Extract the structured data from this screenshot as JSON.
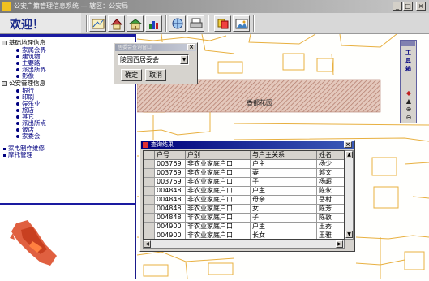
{
  "window": {
    "title": "公安户籍管理信息系统 — 辖区：公安局",
    "controls": {
      "minimize": "_",
      "maximize": "□",
      "close": "×"
    }
  },
  "welcome": "欢迎！",
  "toolbar": {
    "buttons": [
      "map-icon",
      "house-icon",
      "building-icon",
      "chart-icon",
      "globe-icon",
      "print-icon",
      "layers-icon",
      "photo-icon"
    ]
  },
  "tree": {
    "group1": "基础地理信息",
    "group1_items": [
      "家属会界",
      "建筑物",
      "主要路",
      "派出所界",
      "影像"
    ],
    "group2": "公安管理信息",
    "group2_items": [
      "银行",
      "印刷",
      "娱乐业",
      "旅店",
      "其它",
      "派出所点",
      "饭店",
      "家委会"
    ],
    "extra": [
      "家电制作维修",
      "摩托管理"
    ]
  },
  "select_dialog": {
    "title": "居委会查询窗口",
    "selected": "陵园西居委会",
    "ok": "确定",
    "cancel": "取消"
  },
  "map": {
    "area_label": "香都花园"
  },
  "palette": {
    "title": "工具箱",
    "tools": [
      "palette-icon",
      "pointer-icon",
      "zoom-in-icon",
      "zoom-out-icon"
    ]
  },
  "results": {
    "title": "查询结果",
    "columns": [
      "户号",
      "户别",
      "与户主关系",
      "姓名"
    ],
    "rows": [
      [
        "003769",
        "非农业家庭户口",
        "户主",
        "杨少"
      ],
      [
        "003769",
        "非农业家庭户口",
        "妻",
        "郭文"
      ],
      [
        "003769",
        "非农业家庭户口",
        "子",
        "杨超"
      ],
      [
        "004848",
        "非农业家庭户口",
        "户主",
        "陈永"
      ],
      [
        "004848",
        "非农业家庭户口",
        "母亲",
        "岳村"
      ],
      [
        "004848",
        "非农业家庭户口",
        "女",
        "陈芳"
      ],
      [
        "004848",
        "非农业家庭户口",
        "子",
        "陈敦"
      ],
      [
        "004900",
        "非农业家庭户口",
        "户主",
        "王秀"
      ],
      [
        "004900",
        "非农业家庭户口",
        "长女",
        "王雅"
      ]
    ]
  },
  "colors": {
    "title_bar": "#8a8a8a",
    "tree_text": "#000080",
    "map_lines": "#e8b040",
    "hatched_area": "#c08878",
    "results_title": "#00007a",
    "overview_red": "#e05030"
  }
}
